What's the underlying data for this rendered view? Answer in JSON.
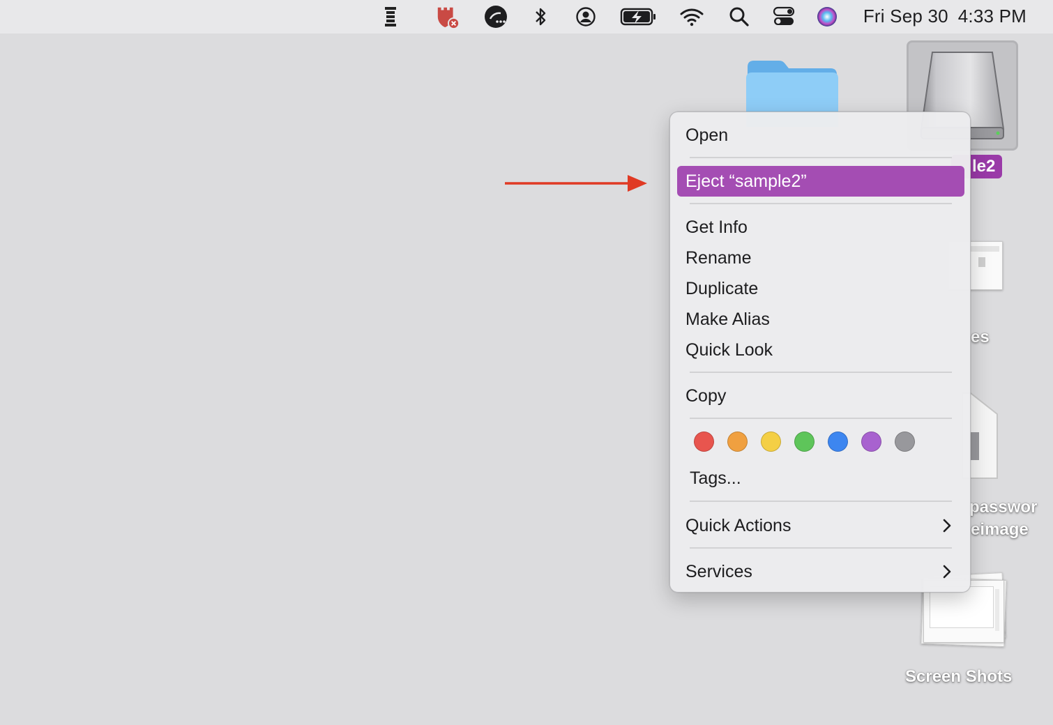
{
  "menubar": {
    "icons": [
      "battery-tower-icon",
      "castle-alert-icon",
      "remote-session-icon",
      "bluetooth-icon",
      "user-account-icon",
      "battery-charging-icon",
      "wifi-icon",
      "search-icon",
      "control-center-icon",
      "siri-icon"
    ],
    "date": "Fri Sep 30",
    "time": "4:33 PM"
  },
  "desktop": {
    "drive_label_fragment": "le2",
    "item_label_fragment_1": "es",
    "item_label_fragment_2a": "passwor",
    "item_label_fragment_2b": "eimage",
    "screenshots_label": "Screen Shots"
  },
  "context_menu": {
    "open": "Open",
    "eject": "Eject “sample2”",
    "get_info": "Get Info",
    "rename": "Rename",
    "duplicate": "Duplicate",
    "make_alias": "Make Alias",
    "quick_look": "Quick Look",
    "copy": "Copy",
    "tags": "Tags...",
    "quick_actions": "Quick Actions",
    "services": "Services",
    "tag_colors": [
      "#e8554e",
      "#f0a040",
      "#f4cf45",
      "#5ec55a",
      "#3d86f0",
      "#a862cf",
      "#98989c"
    ],
    "highlight_color": "#a44db3"
  },
  "annotation": {
    "arrow_color": "#e03a24"
  }
}
